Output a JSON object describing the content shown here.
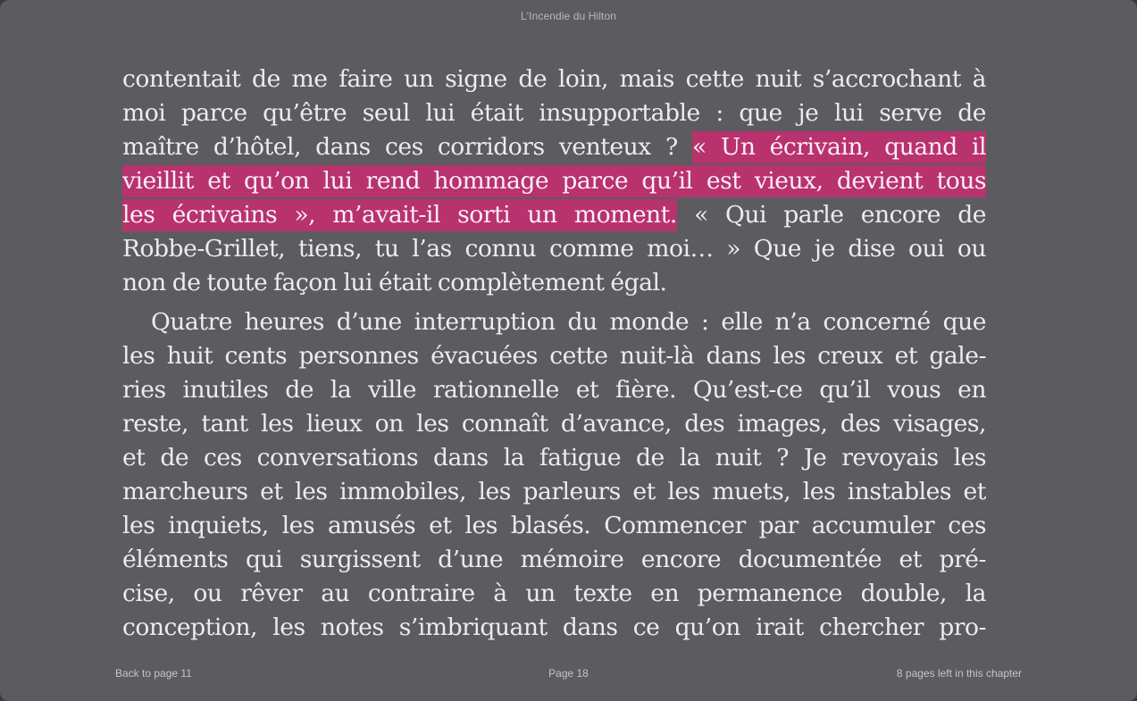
{
  "window": {
    "title": "L'Incendie du Hilton"
  },
  "colors": {
    "background": "#5c5b5f",
    "text": "#ececee",
    "highlight": "#b8326e"
  },
  "paragraph1": {
    "line1": "contentait de me faire un signe de loin, mais cette nuit s’accrochant à",
    "line2": "moi parce qu’être seul lui était insupportable : que je lui serve de",
    "line3_plain": "maître d’hôtel, dans ces corridors venteux ?",
    "line3_hl": "« Un écrivain, quand il",
    "line4_hl": "vieillit et qu’on lui rend hommage parce qu’il est vieux, devient tous",
    "line5_hl": "les écrivains », m’avait-il sorti un moment.",
    "line5_plain": "« Qui parle encore de",
    "line6": "Robbe-Grillet, tiens, tu l’as connu comme moi… » Que je dise oui ou",
    "line7": "non de toute façon lui était complètement égal."
  },
  "paragraph2": {
    "line1": "Quatre heures d’une interruption du monde : elle n’a concerné que",
    "line2": "les huit cents personnes évacuées cette nuit-là dans les creux et gale-",
    "line3": "ries inutiles de la ville rationnelle et fière. Qu’est-ce qu’il vous en",
    "line4": "reste, tant les lieux on les connaît d’avance, des images, des visages,",
    "line5": "et de ces conversations dans la fatigue de la nuit ? Je revoyais les",
    "line6": "marcheurs et les immobiles, les parleurs et les muets, les instables et",
    "line7": "les inquiets, les amusés et les blasés. Commencer par accumuler ces",
    "line8": "éléments qui surgissent d’une mémoire encore documentée et pré-",
    "line9": "cise, ou rêver au contraire à un texte en permanence double, la",
    "line10": "conception, les notes s’imbriquant dans ce qu’on irait chercher pro-"
  },
  "footer": {
    "back_label": "Back to page 11",
    "page_label": "Page 18",
    "remaining_label": "8 pages left in this chapter"
  }
}
